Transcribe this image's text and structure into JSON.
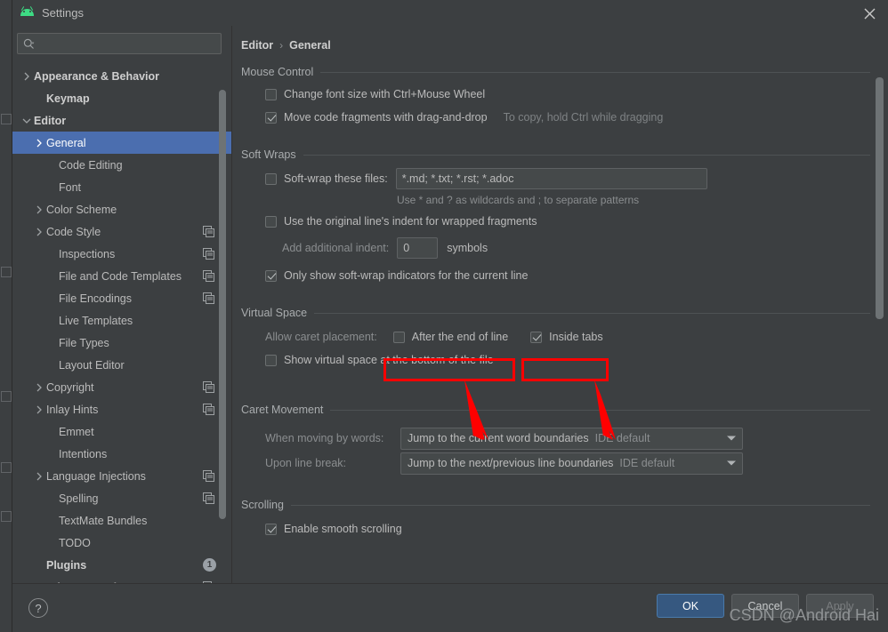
{
  "window": {
    "title": "Settings",
    "logo_icon": "android-logo-icon",
    "close_icon": "close-icon"
  },
  "search": {
    "icon": "search-icon",
    "value": "",
    "placeholder": ""
  },
  "sidebar": {
    "scrollbar": "sidebar-scrollbar",
    "items": [
      {
        "label": "Appearance & Behavior",
        "chevron": "chevron-right-icon",
        "indent": 0,
        "bold": true,
        "selected": false,
        "trailing": ""
      },
      {
        "label": "Keymap",
        "chevron": "",
        "indent": 1,
        "bold": true,
        "selected": false,
        "trailing": ""
      },
      {
        "label": "Editor",
        "chevron": "chevron-down-icon",
        "indent": 0,
        "bold": true,
        "selected": false,
        "trailing": ""
      },
      {
        "label": "General",
        "chevron": "chevron-right-icon",
        "indent": 1,
        "bold": false,
        "selected": true,
        "trailing": ""
      },
      {
        "label": "Code Editing",
        "chevron": "",
        "indent": 2,
        "bold": false,
        "selected": false,
        "trailing": ""
      },
      {
        "label": "Font",
        "chevron": "",
        "indent": 2,
        "bold": false,
        "selected": false,
        "trailing": ""
      },
      {
        "label": "Color Scheme",
        "chevron": "chevron-right-icon",
        "indent": 1,
        "bold": false,
        "selected": false,
        "trailing": ""
      },
      {
        "label": "Code Style",
        "chevron": "chevron-right-icon",
        "indent": 1,
        "bold": false,
        "selected": false,
        "trailing": "copy-icon"
      },
      {
        "label": "Inspections",
        "chevron": "",
        "indent": 2,
        "bold": false,
        "selected": false,
        "trailing": "copy-icon"
      },
      {
        "label": "File and Code Templates",
        "chevron": "",
        "indent": 2,
        "bold": false,
        "selected": false,
        "trailing": "copy-icon"
      },
      {
        "label": "File Encodings",
        "chevron": "",
        "indent": 2,
        "bold": false,
        "selected": false,
        "trailing": "copy-icon"
      },
      {
        "label": "Live Templates",
        "chevron": "",
        "indent": 2,
        "bold": false,
        "selected": false,
        "trailing": ""
      },
      {
        "label": "File Types",
        "chevron": "",
        "indent": 2,
        "bold": false,
        "selected": false,
        "trailing": ""
      },
      {
        "label": "Layout Editor",
        "chevron": "",
        "indent": 2,
        "bold": false,
        "selected": false,
        "trailing": ""
      },
      {
        "label": "Copyright",
        "chevron": "chevron-right-icon",
        "indent": 1,
        "bold": false,
        "selected": false,
        "trailing": "copy-icon"
      },
      {
        "label": "Inlay Hints",
        "chevron": "chevron-right-icon",
        "indent": 1,
        "bold": false,
        "selected": false,
        "trailing": "copy-icon"
      },
      {
        "label": "Emmet",
        "chevron": "",
        "indent": 2,
        "bold": false,
        "selected": false,
        "trailing": ""
      },
      {
        "label": "Intentions",
        "chevron": "",
        "indent": 2,
        "bold": false,
        "selected": false,
        "trailing": ""
      },
      {
        "label": "Language Injections",
        "chevron": "chevron-right-icon",
        "indent": 1,
        "bold": false,
        "selected": false,
        "trailing": "copy-icon"
      },
      {
        "label": "Spelling",
        "chevron": "",
        "indent": 2,
        "bold": false,
        "selected": false,
        "trailing": "copy-icon"
      },
      {
        "label": "TextMate Bundles",
        "chevron": "",
        "indent": 2,
        "bold": false,
        "selected": false,
        "trailing": ""
      },
      {
        "label": "TODO",
        "chevron": "",
        "indent": 2,
        "bold": false,
        "selected": false,
        "trailing": ""
      },
      {
        "label": "Plugins",
        "chevron": "",
        "indent": 1,
        "bold": true,
        "selected": false,
        "trailing": "count",
        "count": "1"
      },
      {
        "label": "Version Control",
        "chevron": "chevron-right-icon",
        "indent": 0,
        "bold": true,
        "selected": false,
        "trailing": "copy-icon"
      }
    ]
  },
  "breadcrumb": {
    "parent": "Editor",
    "separator": "›",
    "current": "General"
  },
  "sections": {
    "mouse_control": {
      "title": "Mouse Control",
      "change_font_size": {
        "label": "Change font size with Ctrl+Mouse Wheel",
        "checked": false
      },
      "move_code_fragments": {
        "label": "Move code fragments with drag-and-drop",
        "checked": true
      },
      "drag_hint": "To copy, hold Ctrl while dragging"
    },
    "soft_wraps": {
      "title": "Soft Wraps",
      "soft_wrap_files": {
        "label": "Soft-wrap these files:",
        "checked": false,
        "value": "*.md; *.txt; *.rst; *.adoc"
      },
      "wildcard_hint": "Use * and ? as wildcards and ; to separate patterns",
      "original_indent": {
        "label": "Use the original line's indent for wrapped fragments",
        "checked": false
      },
      "additional_indent": {
        "label": "Add additional indent:",
        "value": "0",
        "suffix": "symbols"
      },
      "only_show_indicators": {
        "label": "Only show soft-wrap indicators for the current line",
        "checked": true
      }
    },
    "virtual_space": {
      "title": "Virtual Space",
      "allow_caret_label": "Allow caret placement:",
      "after_end_of_line": {
        "label": "After the end of line",
        "checked": false,
        "highlighted": true
      },
      "inside_tabs": {
        "label": "Inside tabs",
        "checked": true,
        "highlighted": true
      },
      "show_virtual_space": {
        "label": "Show virtual space at the bottom of the file",
        "checked": false
      }
    },
    "caret_movement": {
      "title": "Caret Movement",
      "when_moving_by_words": {
        "label": "When moving by words:",
        "value": "Jump to the current word boundaries",
        "suffix": "IDE default",
        "arrow_icon": "chevron-down-icon"
      },
      "upon_line_break": {
        "label": "Upon line break:",
        "value": "Jump to the next/previous line boundaries",
        "suffix": "IDE default",
        "arrow_icon": "chevron-down-icon"
      }
    },
    "scrolling": {
      "title": "Scrolling",
      "enable_smooth_scrolling": {
        "label": "Enable smooth scrolling",
        "checked": true
      }
    }
  },
  "footer": {
    "help_label": "?",
    "ok_label": "OK",
    "cancel_label": "Cancel",
    "apply_label": "Apply"
  },
  "watermark": "CSDN @Android Hai",
  "annotation": {
    "color": "#ff0000",
    "box_count": 2,
    "arrow_count": 2
  }
}
